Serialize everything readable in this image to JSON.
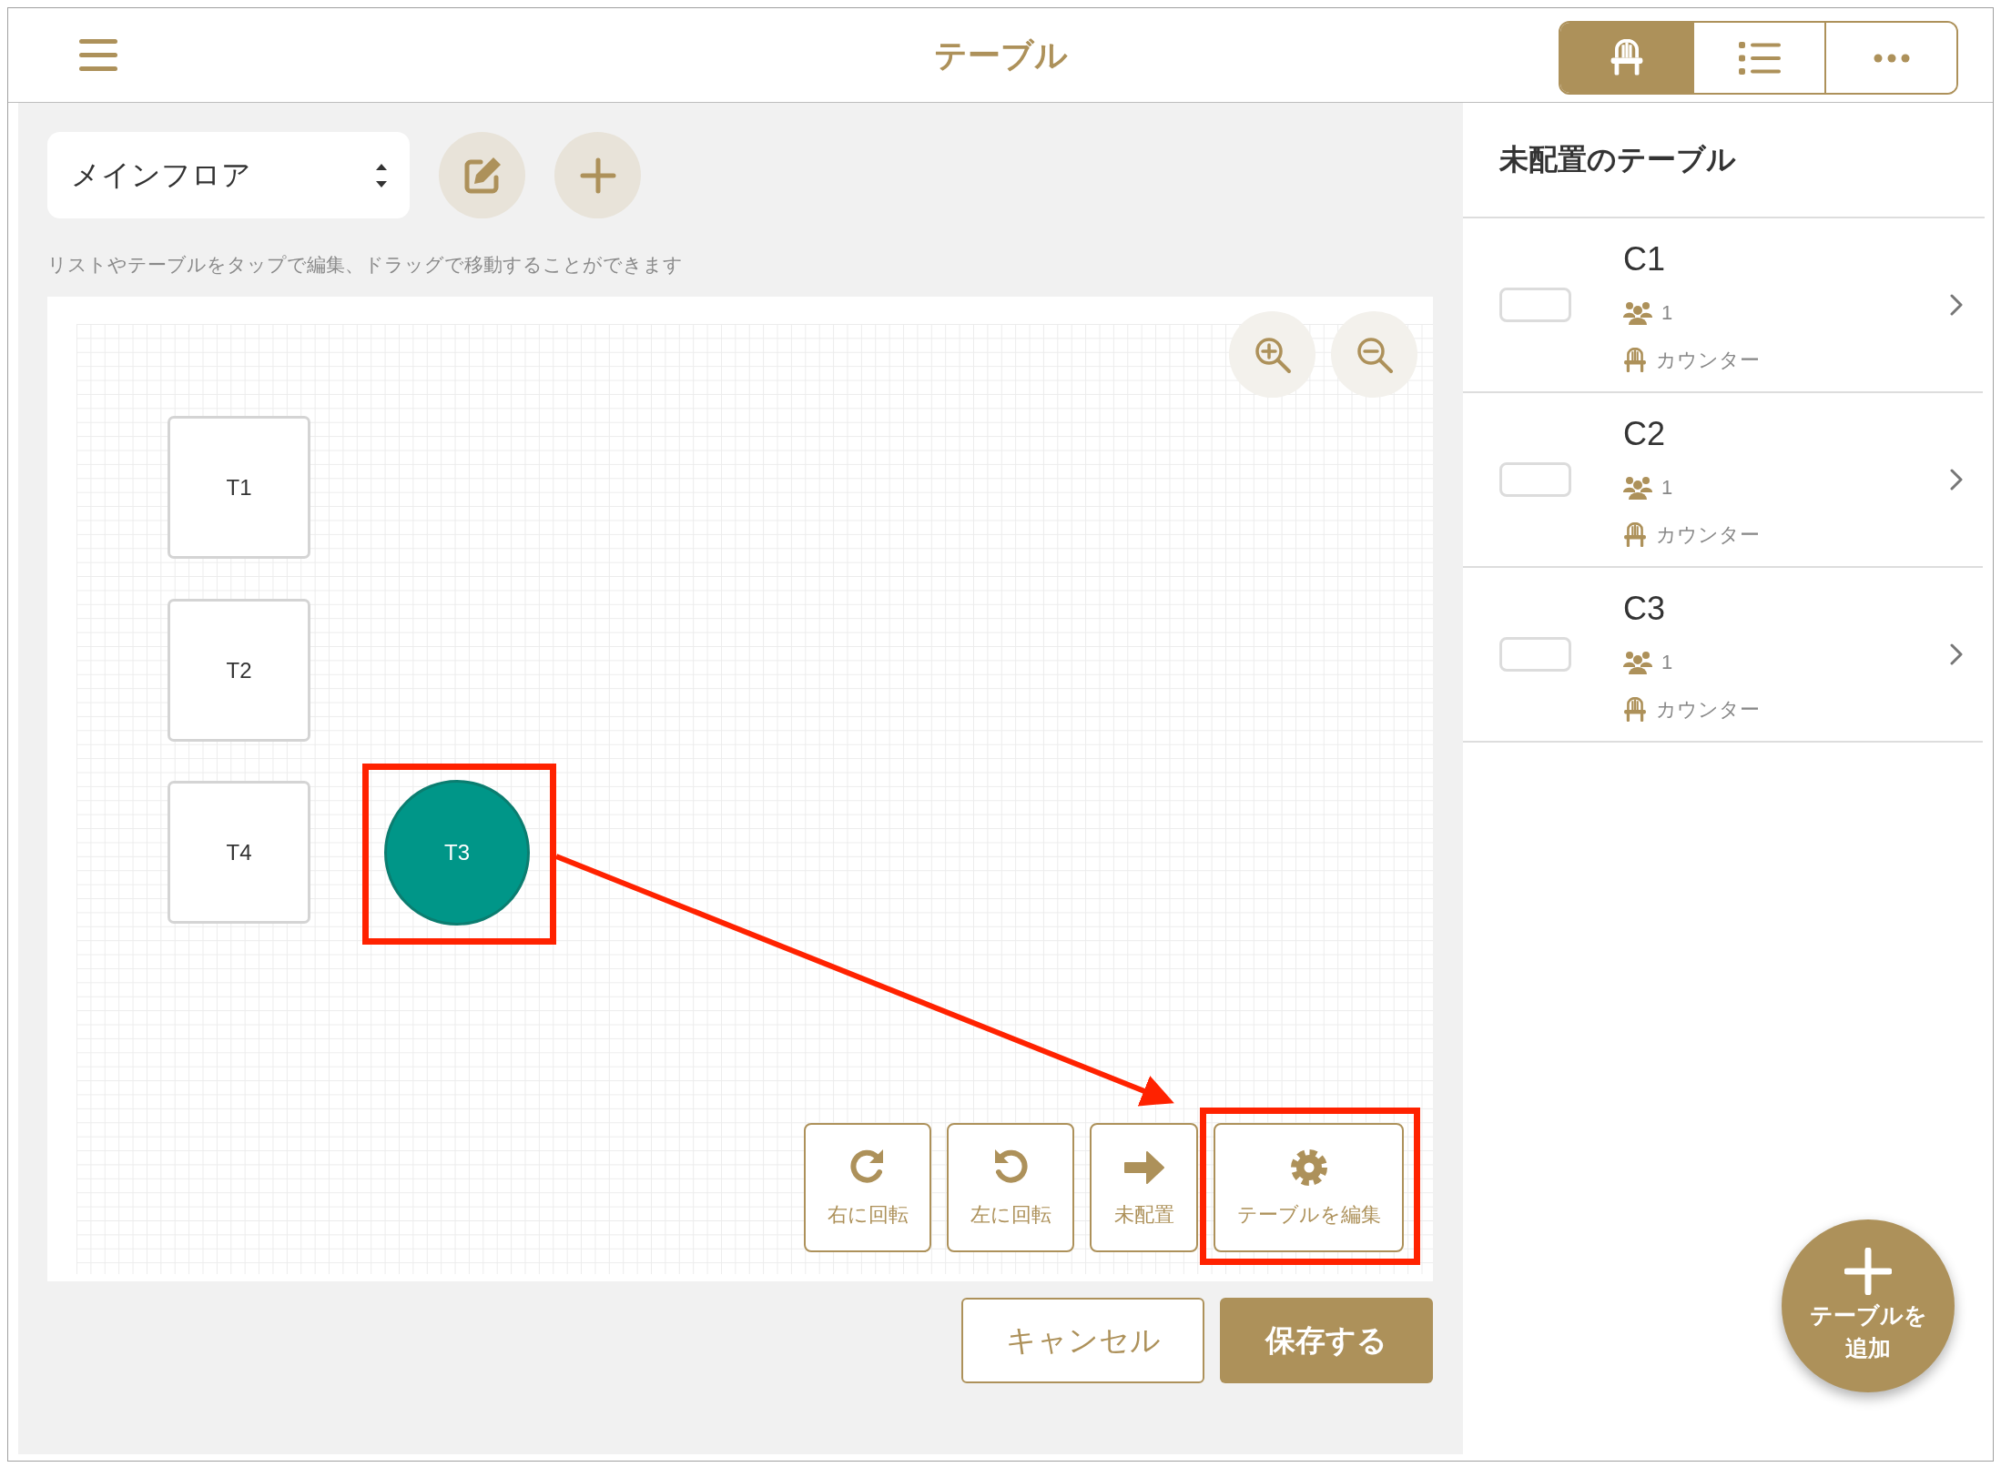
{
  "header": {
    "title": "テーブル",
    "view_tabs": [
      {
        "kind": "floor",
        "selected": true
      },
      {
        "kind": "list",
        "selected": false
      },
      {
        "kind": "more",
        "selected": false
      }
    ]
  },
  "floor_selector": {
    "value": "メインフロア"
  },
  "hint": "リストやテーブルをタップで編集、ドラッグで移動することができます",
  "floor_tables": [
    {
      "label": "T1",
      "kind": "square",
      "selected": false
    },
    {
      "label": "T2",
      "kind": "square",
      "selected": false
    },
    {
      "label": "T4",
      "kind": "square",
      "selected": false
    },
    {
      "label": "T3",
      "kind": "round",
      "selected": true
    }
  ],
  "table_actions": [
    {
      "kind": "rotate_right",
      "label": "右に回転"
    },
    {
      "kind": "rotate_left",
      "label": "左に回転"
    },
    {
      "kind": "unplace",
      "label": "未配置"
    },
    {
      "kind": "edit",
      "label": "テーブルを編集"
    }
  ],
  "footer_buttons": [
    {
      "kind": "secondary",
      "label": "キャンセル"
    },
    {
      "kind": "primary",
      "label": "保存する"
    }
  ],
  "unplaced_panel": {
    "title": "未配置のテーブル",
    "tables": [
      {
        "name": "C1",
        "seats": "1",
        "type": "カウンター"
      },
      {
        "name": "C2",
        "seats": "1",
        "type": "カウンター"
      },
      {
        "name": "C3",
        "seats": "1",
        "type": "カウンター"
      }
    ]
  },
  "add_button": {
    "lines": [
      "テーブルを",
      "追加"
    ]
  }
}
